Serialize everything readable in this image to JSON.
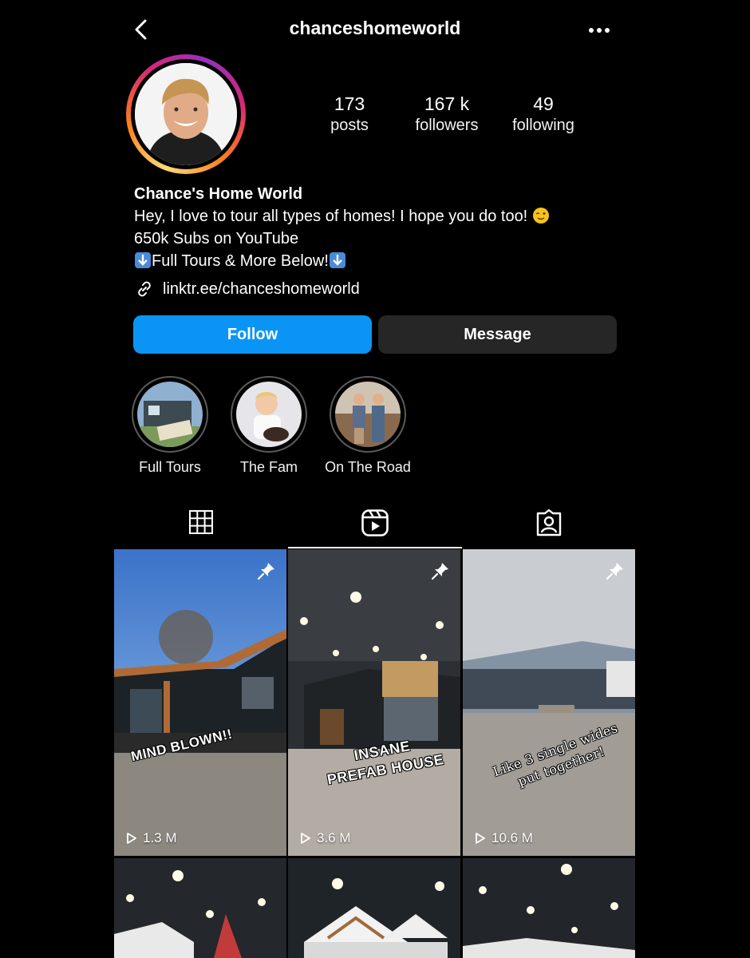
{
  "header": {
    "username": "chanceshomeworld"
  },
  "stats": {
    "posts": {
      "value": "173",
      "label": "posts"
    },
    "followers": {
      "value": "167 k",
      "label": "followers"
    },
    "following": {
      "value": "49",
      "label": "following"
    }
  },
  "bio": {
    "name": "Chance's Home World",
    "line1": "Hey, I love to tour all types of homes! I hope you do too!",
    "line2": "650k Subs on YouTube",
    "line3": "Full Tours & More Below!",
    "link": "linktr.ee/chanceshomeworld"
  },
  "buttons": {
    "follow": "Follow",
    "message": "Message"
  },
  "highlights": [
    {
      "label": "Full Tours"
    },
    {
      "label": "The Fam"
    },
    {
      "label": "On The Road"
    }
  ],
  "tabs": [
    "grid-icon",
    "reels-icon",
    "tagged-icon"
  ],
  "active_tab": "reels",
  "reels": [
    {
      "views": "1.3 M",
      "caption": "MIND BLOWN!!",
      "pinned": true
    },
    {
      "views": "3.6 M",
      "caption_line1": "INSANE",
      "caption_line2": "PREFAB HOUSE",
      "pinned": true
    },
    {
      "views": "10.6 M",
      "caption_line1": "Like 3 single wides",
      "caption_line2": "put together!",
      "pinned": true
    }
  ],
  "colors": {
    "follow_button": "#0a95f6",
    "message_button": "#262626",
    "background": "#000000"
  }
}
